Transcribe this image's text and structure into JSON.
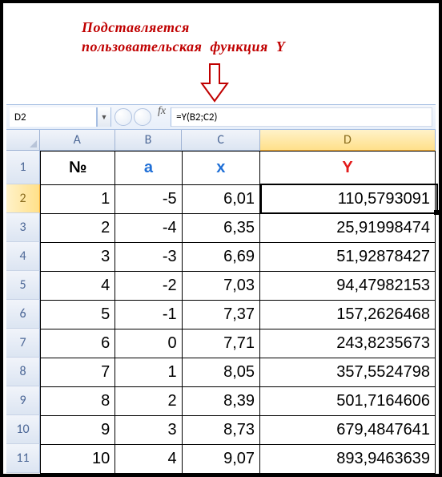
{
  "caption_line1": "Подставляется",
  "caption_line2": "пользовательская  функция  Y",
  "name_box": {
    "value": "D2",
    "dropdown_glyph": "▼"
  },
  "formula_bar": {
    "fx_label": "fx",
    "value": "=Y(B2;C2)"
  },
  "columns": {
    "A": "A",
    "B": "B",
    "C": "C",
    "D": "D"
  },
  "col_widths": {
    "A": 94,
    "B": 84,
    "C": 98,
    "D": 220
  },
  "row_header_height": 42,
  "data_row_height": 36,
  "selected_col": "D",
  "selected_row": 2,
  "headers": {
    "no": "№",
    "a": "a",
    "x": "x",
    "y": "Y"
  },
  "rows": [
    {
      "r": 2,
      "no": "1",
      "a": "-5",
      "x": "6,01",
      "y": "110,5793091"
    },
    {
      "r": 3,
      "no": "2",
      "a": "-4",
      "x": "6,35",
      "y": "25,91998474"
    },
    {
      "r": 4,
      "no": "3",
      "a": "-3",
      "x": "6,69",
      "y": "51,92878427"
    },
    {
      "r": 5,
      "no": "4",
      "a": "-2",
      "x": "7,03",
      "y": "94,47982153"
    },
    {
      "r": 6,
      "no": "5",
      "a": "-1",
      "x": "7,37",
      "y": "157,2626468"
    },
    {
      "r": 7,
      "no": "6",
      "a": "0",
      "x": "7,71",
      "y": "243,8235673"
    },
    {
      "r": 8,
      "no": "7",
      "a": "1",
      "x": "8,05",
      "y": "357,5524798"
    },
    {
      "r": 9,
      "no": "8",
      "a": "2",
      "x": "8,39",
      "y": "501,7164606"
    },
    {
      "r": 10,
      "no": "9",
      "a": "3",
      "x": "8,73",
      "y": "679,4847641"
    },
    {
      "r": 11,
      "no": "10",
      "a": "4",
      "x": "9,07",
      "y": "893,9463639"
    }
  ]
}
